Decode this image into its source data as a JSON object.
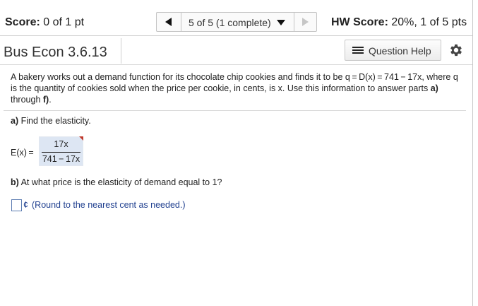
{
  "header": {
    "score_label": "Score:",
    "score_value": "0 of 1 pt",
    "nav": {
      "position_text": "5 of 5 (1 complete)",
      "prev_icon": "triangle-left-icon",
      "next_icon": "triangle-right-icon",
      "dropdown_icon": "caret-down-icon"
    },
    "hw_score_label": "HW Score:",
    "hw_score_value": "20%, 1 of 5 pts"
  },
  "titlebar": {
    "title": "Bus Econ 3.6.13",
    "question_help_label": "Question Help",
    "question_help_icon": "list-icon",
    "settings_icon": "gear-icon"
  },
  "question": {
    "text_1": "A bakery works out a demand function for its chocolate chip cookies and finds it to be q = D(x) = 741 − 17x, where q is the quantity of cookies sold when the price per cookie, in cents, is x. Use this information to answer parts ",
    "part_a_ref": "a)",
    "text_2": " through ",
    "part_f_ref": "f)",
    "text_3": "."
  },
  "part_a": {
    "label": "a)",
    "prompt": " Find the elasticity.",
    "answer_label": "E(x) =",
    "numerator": "17x",
    "denominator": "741 − 17x"
  },
  "part_b": {
    "label": "b)",
    "prompt": " At what price is the elasticity of demand equal to 1?",
    "input_value": "",
    "unit": "¢",
    "hint": "(Round to the nearest cent as needed.)"
  },
  "colors": {
    "hint_text": "#1f3f8f",
    "answer_highlight": "#dde6f3",
    "flag": "#c0392b"
  }
}
